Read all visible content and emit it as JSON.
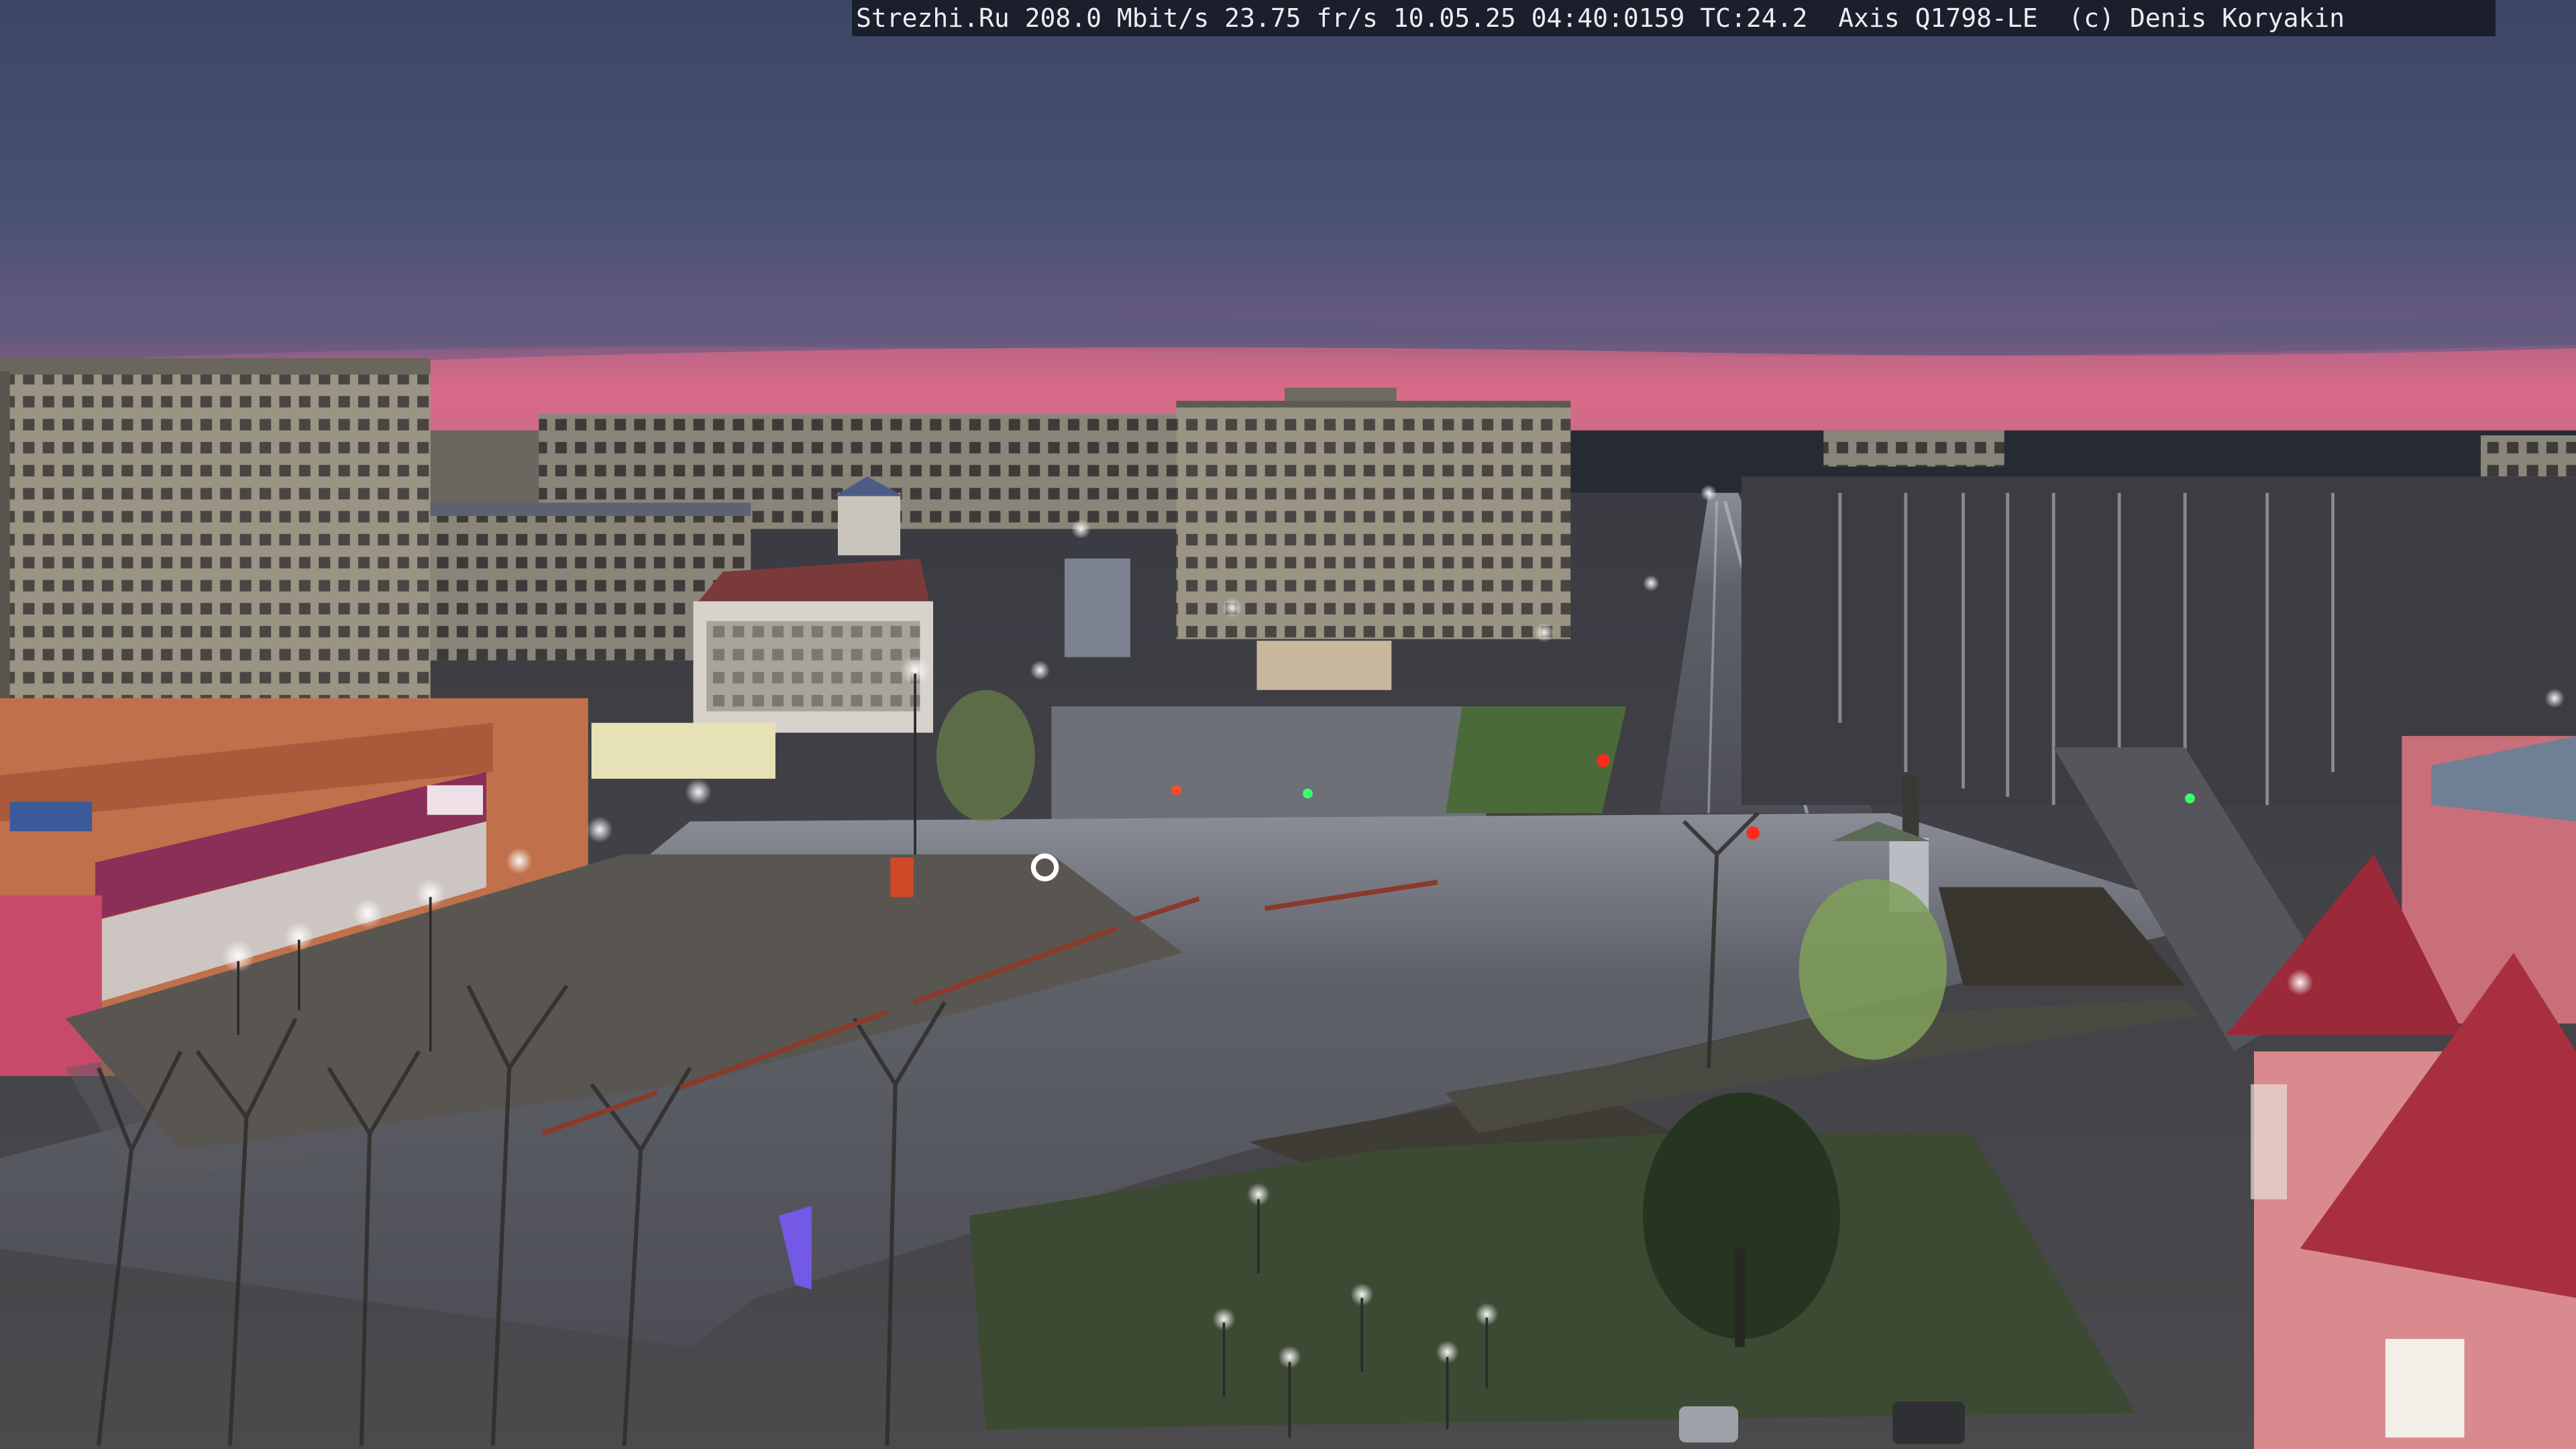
{
  "overlay": {
    "caption": "Strezhi.Ru 208.0 Mbit/s 23.75 fr/s 10.05.25 04:40:0159 TC:24.2  Axis Q1798-LE  (c) Denis Koryakin"
  },
  "scene": {
    "subject": "Webcam view over a town square and a long straight avenue at dawn",
    "sky_colors": {
      "top": "#3c4665",
      "glow": "#e06a86",
      "horizon": "#c95a78"
    },
    "street_light_color": "#f4f8ff",
    "traffic_light_color": "#ff2a1a"
  }
}
